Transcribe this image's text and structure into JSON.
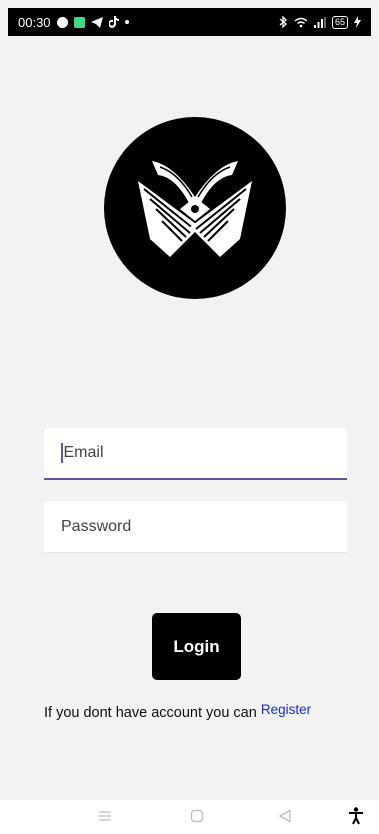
{
  "status_bar": {
    "time": "00:30",
    "battery": "65",
    "left_icons": [
      "spotify-icon",
      "app-icon",
      "telegram-icon",
      "tiktok-icon",
      "dot-icon"
    ],
    "right_icons": [
      "bluetooth-icon",
      "wifi-icon",
      "signal-icon",
      "battery-icon",
      "charging-icon"
    ]
  },
  "logo": {
    "icon": "crossed-books-logo",
    "background": "#000000"
  },
  "form": {
    "email": {
      "placeholder": "Email",
      "value": ""
    },
    "password": {
      "placeholder": "Password",
      "value": ""
    }
  },
  "login_button": {
    "label": "Login"
  },
  "register": {
    "prompt": "If you dont have account you can",
    "link_label": "Register"
  },
  "nav_bar": {
    "icons": [
      "menu-icon",
      "home-icon",
      "back-icon",
      "accessibility-icon"
    ]
  },
  "colors": {
    "accent": "#6750a4",
    "link": "#1a2bd8",
    "button": "#000000",
    "background": "#f2f2f2"
  }
}
